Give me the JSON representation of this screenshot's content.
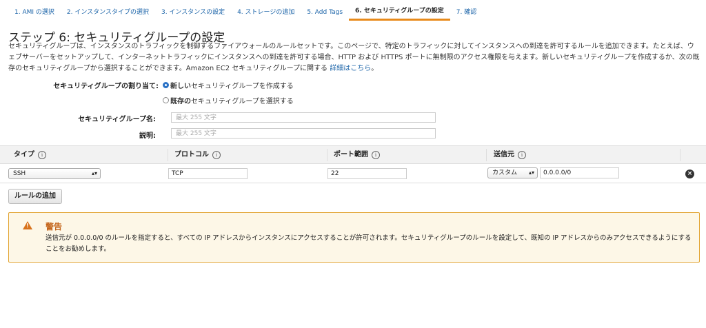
{
  "tabs": [
    {
      "label": "1. AMI の選択"
    },
    {
      "label": "2. インスタンスタイプの選択"
    },
    {
      "label": "3. インスタンスの設定"
    },
    {
      "label": "4. ストレージの追加"
    },
    {
      "label": "5. Add Tags"
    },
    {
      "label": "6. セキュリティグループの設定"
    },
    {
      "label": "7. 確認"
    }
  ],
  "page": {
    "title": "ステップ 6: セキュリティグループの設定",
    "description": "セキュリティグループは、インスタンスのトラフィックを制御するファイアウォールのルールセットです。このページで、特定のトラフィックに対してインスタンスへの到達を許可するルールを追加できます。たとえば、ウェブサーバーをセットアップして、インターネットトラフィックにインスタンスへの到達を許可する場合、HTTP および HTTPS ポートに無制限のアクセス権限を与えます。新しいセキュリティグループを作成するか、次の既存のセキュリティグループから選択することができます。Amazon EC2 セキュリティグループに関する ",
    "details_link": "詳細はこちら",
    "description_end": "。"
  },
  "form": {
    "assign_label": "セキュリティグループの割り当て:",
    "radio_new_bold": "新しい",
    "radio_new_rest": "セキュリティグループを作成する",
    "radio_existing_bold": "既存の",
    "radio_existing_rest": "セキュリティグループを選択する",
    "name_label": "セキュリティグループ名:",
    "name_placeholder": "最大 255 文字",
    "desc_label": "説明:",
    "desc_placeholder": "最大 255 文字"
  },
  "table": {
    "headers": [
      "タイプ",
      "プロトコル",
      "ポート範囲",
      "送信元"
    ],
    "info_glyph": "i",
    "row": {
      "type": "SSH",
      "protocol": "TCP",
      "port": "22",
      "source_type": "カスタム",
      "source_value": "0.0.0.0/0"
    }
  },
  "add_rule_label": "ルールの追加",
  "warning": {
    "title": "警告",
    "text": "送信元が 0.0.0.0/0 のルールを指定すると、すべての IP アドレスからインスタンスにアクセスすることが許可されます。セキュリティグループのルールを設定して、既知の IP アドレスからのみアクセスできるようにすることをお勧めします。"
  },
  "colors": {
    "link": "#1a63a8",
    "active_tab_underline": "#e88a1a",
    "warning_border": "#e2a330",
    "warning_title": "#c4641a"
  }
}
